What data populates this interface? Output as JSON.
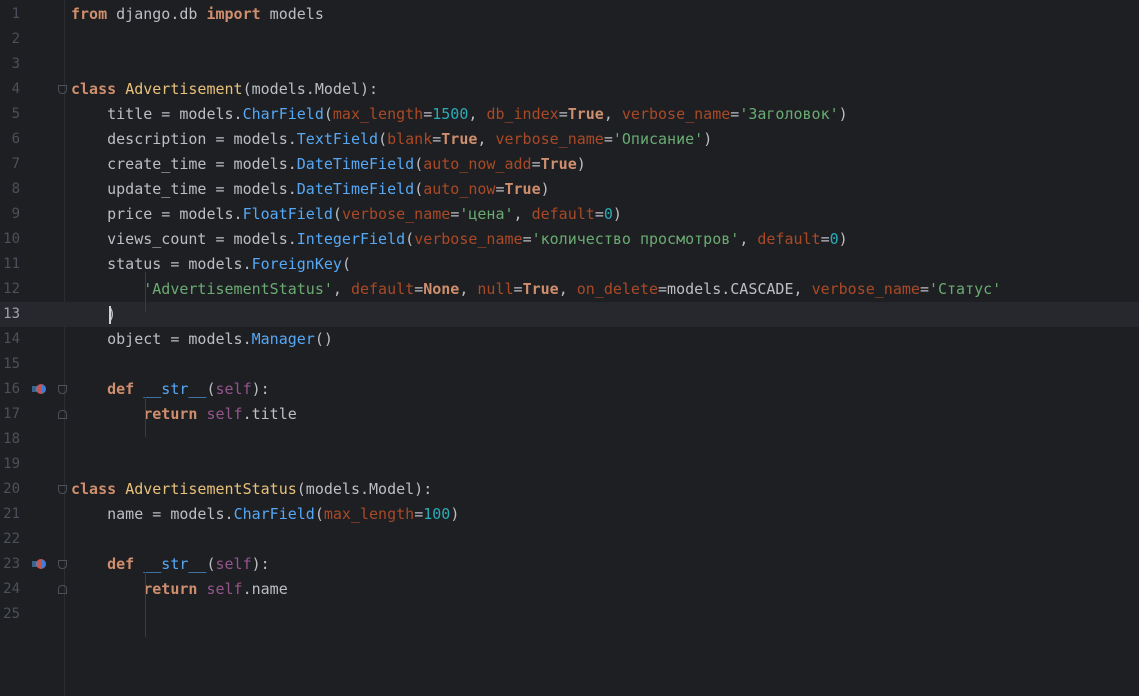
{
  "editor": {
    "current_line": 13,
    "lines": [
      {
        "n": "1",
        "tokens": [
          [
            "kwb",
            "from"
          ],
          [
            "",
            " django.db "
          ],
          [
            "kwb",
            "import"
          ],
          [
            "",
            " models"
          ]
        ]
      },
      {
        "n": "2",
        "tokens": []
      },
      {
        "n": "3",
        "tokens": []
      },
      {
        "n": "4",
        "tokens": [
          [
            "kwb",
            "class"
          ],
          [
            "",
            " "
          ],
          [
            "cls",
            "Advertisement"
          ],
          [
            "",
            "(models.Model):"
          ]
        ]
      },
      {
        "n": "5",
        "tokens": [
          [
            "",
            "    title = models."
          ],
          [
            "call",
            "CharField"
          ],
          [
            "",
            "("
          ],
          [
            "param",
            "max_length"
          ],
          [
            "",
            "="
          ],
          [
            "num",
            "1500"
          ],
          [
            "",
            ", "
          ],
          [
            "param",
            "db_index"
          ],
          [
            "",
            "="
          ],
          [
            "kwb",
            "True"
          ],
          [
            "",
            ", "
          ],
          [
            "param",
            "verbose_name"
          ],
          [
            "",
            "="
          ],
          [
            "str",
            "'Заголовок'"
          ],
          [
            "",
            ")"
          ]
        ]
      },
      {
        "n": "6",
        "tokens": [
          [
            "",
            "    description = models."
          ],
          [
            "call",
            "TextField"
          ],
          [
            "",
            "("
          ],
          [
            "param",
            "blank"
          ],
          [
            "",
            "="
          ],
          [
            "kwb",
            "True"
          ],
          [
            "",
            ", "
          ],
          [
            "param",
            "verbose_name"
          ],
          [
            "",
            "="
          ],
          [
            "str",
            "'Описание'"
          ],
          [
            "",
            ")"
          ]
        ]
      },
      {
        "n": "7",
        "tokens": [
          [
            "",
            "    create_time = models."
          ],
          [
            "call",
            "DateTimeField"
          ],
          [
            "",
            "("
          ],
          [
            "param",
            "auto_now_add"
          ],
          [
            "",
            "="
          ],
          [
            "kwb",
            "True"
          ],
          [
            "",
            ")"
          ]
        ]
      },
      {
        "n": "8",
        "tokens": [
          [
            "",
            "    update_time = models."
          ],
          [
            "call",
            "DateTimeField"
          ],
          [
            "",
            "("
          ],
          [
            "param",
            "auto_now"
          ],
          [
            "",
            "="
          ],
          [
            "kwb",
            "True"
          ],
          [
            "",
            ")"
          ]
        ]
      },
      {
        "n": "9",
        "tokens": [
          [
            "",
            "    price = models."
          ],
          [
            "call",
            "FloatField"
          ],
          [
            "",
            "("
          ],
          [
            "param",
            "verbose_name"
          ],
          [
            "",
            "="
          ],
          [
            "str",
            "'цена'"
          ],
          [
            "",
            ", "
          ],
          [
            "param",
            "default"
          ],
          [
            "",
            "="
          ],
          [
            "num",
            "0"
          ],
          [
            "",
            ")"
          ]
        ]
      },
      {
        "n": "10",
        "tokens": [
          [
            "",
            "    views_count = models."
          ],
          [
            "call",
            "IntegerField"
          ],
          [
            "",
            "("
          ],
          [
            "param",
            "verbose_name"
          ],
          [
            "",
            "="
          ],
          [
            "str",
            "'количество просмотров'"
          ],
          [
            "",
            ", "
          ],
          [
            "param",
            "default"
          ],
          [
            "",
            "="
          ],
          [
            "num",
            "0"
          ],
          [
            "",
            ")"
          ]
        ]
      },
      {
        "n": "11",
        "tokens": [
          [
            "",
            "    status = models."
          ],
          [
            "call",
            "ForeignKey"
          ],
          [
            "",
            "("
          ]
        ]
      },
      {
        "n": "12",
        "tokens": [
          [
            "",
            "        "
          ],
          [
            "str",
            "'AdvertisementStatus'"
          ],
          [
            "",
            ", "
          ],
          [
            "param",
            "default"
          ],
          [
            "",
            "="
          ],
          [
            "kwb",
            "None"
          ],
          [
            "",
            ", "
          ],
          [
            "param",
            "null"
          ],
          [
            "",
            "="
          ],
          [
            "kwb",
            "True"
          ],
          [
            "",
            ", "
          ],
          [
            "param",
            "on_delete"
          ],
          [
            "",
            "=models.CASCADE, "
          ],
          [
            "param",
            "verbose_name"
          ],
          [
            "",
            "="
          ],
          [
            "str",
            "'Статус'"
          ]
        ]
      },
      {
        "n": "13",
        "tokens": [
          [
            "",
            "    )"
          ]
        ]
      },
      {
        "n": "14",
        "tokens": [
          [
            "",
            "    object = models."
          ],
          [
            "call",
            "Manager"
          ],
          [
            "",
            "()"
          ]
        ]
      },
      {
        "n": "15",
        "tokens": []
      },
      {
        "n": "16",
        "tokens": [
          [
            "",
            "    "
          ],
          [
            "kwb",
            "def"
          ],
          [
            "",
            " "
          ],
          [
            "call",
            "__str__"
          ],
          [
            "",
            "("
          ],
          [
            "self",
            "self"
          ],
          [
            "",
            "):"
          ]
        ]
      },
      {
        "n": "17",
        "tokens": [
          [
            "",
            "        "
          ],
          [
            "kwb",
            "return"
          ],
          [
            "",
            " "
          ],
          [
            "self",
            "self"
          ],
          [
            "",
            ".title"
          ]
        ]
      },
      {
        "n": "18",
        "tokens": []
      },
      {
        "n": "19",
        "tokens": []
      },
      {
        "n": "20",
        "tokens": [
          [
            "kwb",
            "class"
          ],
          [
            "",
            " "
          ],
          [
            "cls",
            "AdvertisementStatus"
          ],
          [
            "",
            "(models.Model):"
          ]
        ]
      },
      {
        "n": "21",
        "tokens": [
          [
            "",
            "    name = models."
          ],
          [
            "call",
            "CharField"
          ],
          [
            "",
            "("
          ],
          [
            "param",
            "max_length"
          ],
          [
            "",
            "="
          ],
          [
            "num",
            "100"
          ],
          [
            "",
            ")"
          ]
        ]
      },
      {
        "n": "22",
        "tokens": []
      },
      {
        "n": "23",
        "tokens": [
          [
            "",
            "    "
          ],
          [
            "kwb",
            "def"
          ],
          [
            "",
            " "
          ],
          [
            "call",
            "__str__"
          ],
          [
            "",
            "("
          ],
          [
            "self",
            "self"
          ],
          [
            "",
            "):"
          ]
        ]
      },
      {
        "n": "24",
        "tokens": [
          [
            "",
            "        "
          ],
          [
            "kwb",
            "return"
          ],
          [
            "",
            " "
          ],
          [
            "self",
            "self"
          ],
          [
            "",
            ".name"
          ]
        ]
      },
      {
        "n": "25",
        "tokens": []
      }
    ],
    "gutter_icons": [
      {
        "line": 16,
        "name": "override-method-icon"
      },
      {
        "line": 23,
        "name": "override-method-icon"
      }
    ],
    "fold_markers": [
      {
        "line": 4,
        "kind": "open"
      },
      {
        "line": 16,
        "kind": "open"
      },
      {
        "line": 17,
        "kind": "close"
      },
      {
        "line": 20,
        "kind": "open"
      },
      {
        "line": 23,
        "kind": "open"
      },
      {
        "line": 24,
        "kind": "close"
      }
    ]
  }
}
